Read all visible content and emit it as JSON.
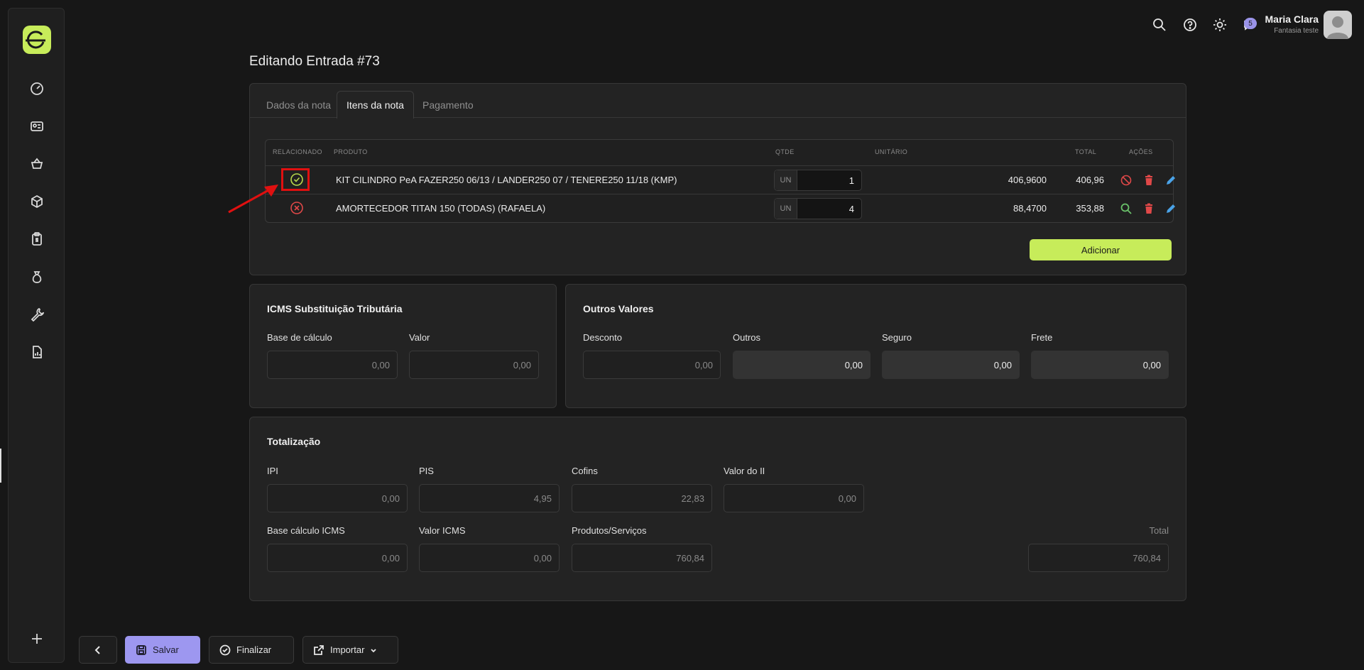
{
  "user": {
    "name": "Maria Clara",
    "company": "Fantasia teste",
    "notifications": "5"
  },
  "page": {
    "title": "Editando Entrada #73"
  },
  "tabs": [
    {
      "label": "Dados da nota"
    },
    {
      "label": "Itens da nota"
    },
    {
      "label": "Pagamento"
    }
  ],
  "table": {
    "headers": {
      "related": "RELACIONADO",
      "product": "PRODUTO",
      "qty": "QTDE",
      "unit": "UNITÁRIO",
      "total": "TOTAL",
      "actions": "AÇÕES"
    },
    "rows": [
      {
        "product": "KIT CILINDRO PeA FAZER250 06/13 / LANDER250 07 / TENERE250 11/18 (KMP)",
        "unit_type": "UN",
        "qty": "1",
        "unit_price": "406,9600",
        "total": "406,96",
        "related": true
      },
      {
        "product": "AMORTECEDOR TITAN 150 (TODAS) (RAFAELA)",
        "unit_type": "UN",
        "qty": "4",
        "unit_price": "88,4700",
        "total": "353,88",
        "related": false
      }
    ],
    "add_label": "Adicionar"
  },
  "icms_st": {
    "title": "ICMS Substituição Tributária",
    "base_label": "Base de cálculo",
    "base_value": "0,00",
    "valor_label": "Valor",
    "valor_value": "0,00"
  },
  "outros": {
    "title": "Outros Valores",
    "desconto_label": "Desconto",
    "desconto_value": "0,00",
    "outros_label": "Outros",
    "outros_value": "0,00",
    "seguro_label": "Seguro",
    "seguro_value": "0,00",
    "frete_label": "Frete",
    "frete_value": "0,00"
  },
  "totalizacao": {
    "title": "Totalização",
    "ipi_label": "IPI",
    "ipi_value": "0,00",
    "pis_label": "PIS",
    "pis_value": "4,95",
    "cofins_label": "Cofins",
    "cofins_value": "22,83",
    "ii_label": "Valor do II",
    "ii_value": "0,00",
    "base_icms_label": "Base cálculo ICMS",
    "base_icms_value": "0,00",
    "valor_icms_label": "Valor ICMS",
    "valor_icms_value": "0,00",
    "produtos_label": "Produtos/Serviços",
    "produtos_value": "760,84",
    "total_label": "Total",
    "total_value": "760,84"
  },
  "footer": {
    "save_label": "Salvar",
    "finish_label": "Finalizar",
    "import_label": "Importar"
  },
  "colors": {
    "accent": "#c7ec5a",
    "primary_button": "#9d97f0",
    "danger": "#e04848",
    "success": "#6ac26a",
    "edit": "#4aa3e8"
  }
}
